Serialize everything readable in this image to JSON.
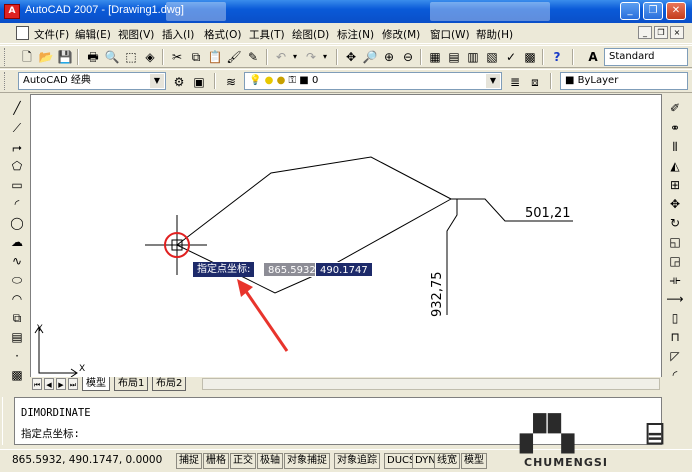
{
  "window": {
    "title": "AutoCAD 2007 - [Drawing1.dwg]",
    "app_icon": "A",
    "minimize": "_",
    "restore": "❐",
    "close": "✕"
  },
  "menu": {
    "items": [
      "文件(F)",
      "编辑(E)",
      "视图(V)",
      "插入(I)",
      "格式(O)",
      "工具(T)",
      "绘图(D)",
      "标注(N)",
      "修改(M)",
      "窗口(W)",
      "帮助(H)"
    ],
    "mdi_min": "_",
    "mdi_restore": "❐",
    "mdi_close": "×"
  },
  "toolbars": {
    "text_style": "Standard",
    "workspace": "AutoCAD 经典",
    "layer": "0",
    "color": "ByLayer"
  },
  "drawing": {
    "dim_horizontal": "501,21",
    "dim_vertical": "932,75",
    "ucs_x": "X",
    "ucs_y": "Y",
    "tooltip_label": "指定点坐标:",
    "input_x": "865.5932",
    "input_y": "490.1747"
  },
  "tabs": {
    "items": [
      "模型",
      "布局1",
      "布局2"
    ],
    "active": "模型"
  },
  "command": {
    "line1": "DIMORDINATE",
    "line2": "指定点坐标:"
  },
  "status": {
    "coords": "865.5932,  490.1747,  0.0000",
    "buttons": [
      "捕捉",
      "栅格",
      "正交",
      "极轴",
      "对象捕捉",
      "对象追踪",
      "DUCS",
      "DYN",
      "线宽",
      "模型"
    ]
  },
  "watermark": {
    "brand": "CHUMENGSI"
  },
  "colors": {
    "title_bar": "#0a5ad8",
    "tooltip_bg": "#1d2a6a",
    "highlight_circle": "#e02020",
    "arrow": "#e8342c"
  }
}
